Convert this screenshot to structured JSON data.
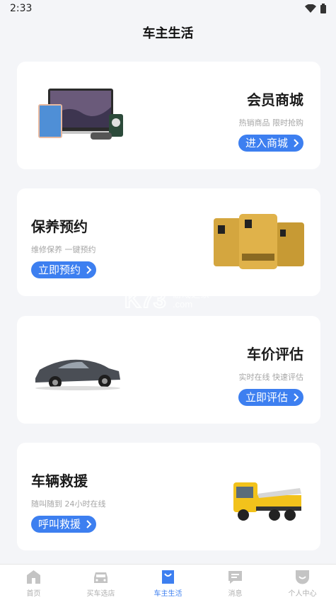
{
  "status": {
    "time": "2:33"
  },
  "header": {
    "title": "车主生活"
  },
  "cards": [
    {
      "title": "会员商城",
      "subtitle": "热销商品 限时抢购",
      "button": "进入商城",
      "image": "electronics-products-image"
    },
    {
      "title": "保养预约",
      "subtitle": "维修保养 一键预约",
      "button": "立即预约",
      "image": "motor-oil-bottles-image"
    },
    {
      "title": "车价评估",
      "subtitle": "实时在线 快速评估",
      "button": "立即评估",
      "image": "sedan-car-image"
    },
    {
      "title": "车辆救援",
      "subtitle": "随叫随到 24小时在线",
      "button": "呼叫救援",
      "image": "tow-truck-image"
    }
  ],
  "watermark": {
    "logo": "K73",
    "text": "游戏之家",
    "domain": ".com"
  },
  "tabs": [
    {
      "label": "首页",
      "icon": "home-icon",
      "active": false
    },
    {
      "label": "买车选店",
      "icon": "car-icon",
      "active": false
    },
    {
      "label": "车主生活",
      "icon": "bag-icon",
      "active": true
    },
    {
      "label": "消息",
      "icon": "message-icon",
      "active": false
    },
    {
      "label": "个人中心",
      "icon": "profile-icon",
      "active": false
    }
  ],
  "colors": {
    "accent": "#3d7ff0",
    "background": "#f4f5f8",
    "inactive": "#b0b0b0"
  }
}
